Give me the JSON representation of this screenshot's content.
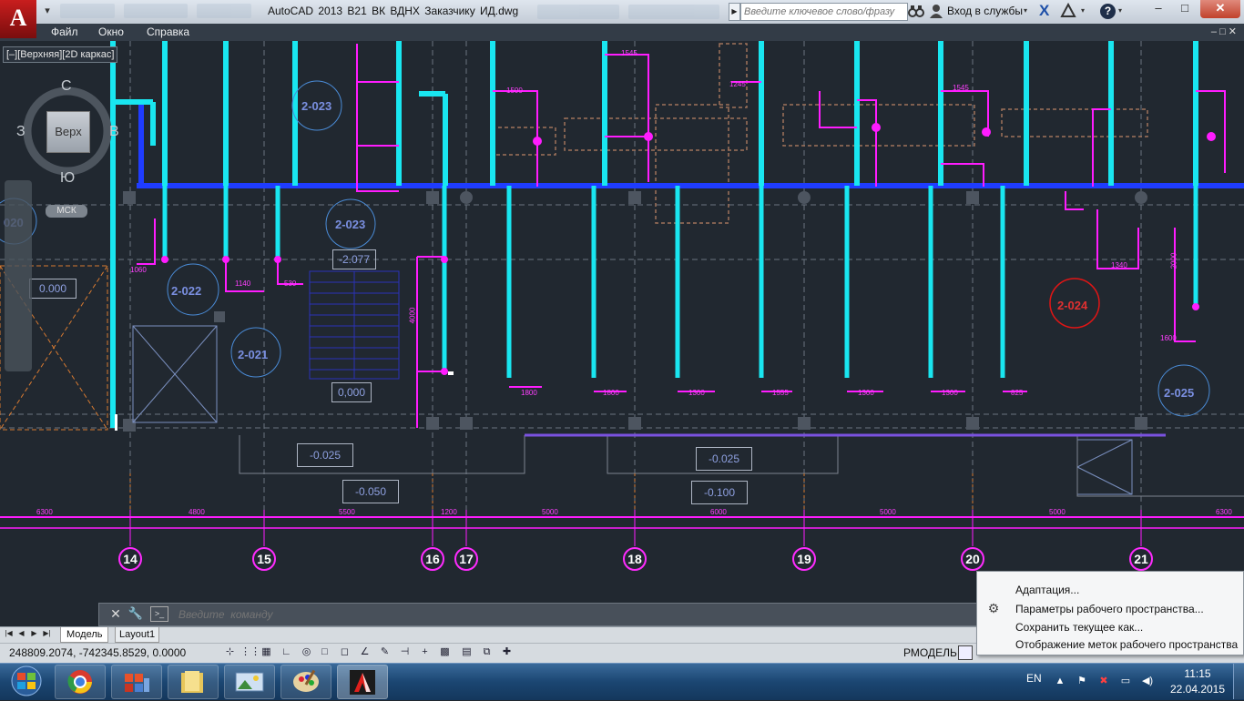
{
  "window": {
    "app_logo": "A",
    "title": "AutoCAD 2013    B21  ВК  ВДНХ  Заказчику ИД.dwg",
    "search_placeholder": "Введите ключевое слово/фразу",
    "signin_label": "Вход в службы",
    "help_label": "?",
    "minimize_label": "–",
    "maximize_label": "□",
    "close_label": "✕"
  },
  "menubar": {
    "items": [
      "Файл",
      "Окно",
      "Справка"
    ],
    "doc_controls": "–  □  ✕"
  },
  "viewport": {
    "label": "[–][Верхняя][2D каркас]",
    "viewcube": {
      "north": "С",
      "south": "Ю",
      "west": "З",
      "east": "В",
      "face": "Верх",
      "ucs": "МСК"
    }
  },
  "drawing": {
    "grid_labels": [
      "14",
      "15",
      "16",
      "17",
      "18",
      "19",
      "20",
      "21"
    ],
    "room_tags": [
      "2-023",
      "2-023",
      "2-022",
      "2-021",
      "2-024",
      "2-025",
      "020"
    ],
    "level_marks": [
      "0.000",
      "-2.077",
      "0,000",
      "-0.025",
      "-0.050",
      "-0.025",
      "-0.100"
    ],
    "dimensions": [
      "6300",
      "4800",
      "5500",
      "1200",
      "5000",
      "6000",
      "5000",
      "5000",
      "6300",
      "5000"
    ],
    "pipe_dims": [
      "1140",
      "530",
      "1800",
      "1800",
      "1300",
      "1555",
      "1300",
      "1300",
      "825",
      "1340",
      "1600",
      "1545",
      "1545",
      "1245",
      "1060",
      "2000",
      "1500",
      "4000"
    ]
  },
  "command_line": {
    "placeholder": "Введите  команду",
    "close_icon": "✕",
    "settings_icon": "🔧"
  },
  "layout_tabs": {
    "tabs": [
      "Модель",
      "Layout1"
    ]
  },
  "statusbar": {
    "coords": "248809.2074, -742345.8529, 0.0000",
    "model_label": "РМОДЕЛЬ"
  },
  "context_menu": {
    "items": [
      "Адаптация...",
      "Параметры рабочего пространства...",
      "Сохранить текущее как...",
      "Отображение меток рабочего пространства"
    ]
  },
  "taskbar": {
    "lang": "EN",
    "time": "11:15",
    "date": "22.04.2015"
  }
}
